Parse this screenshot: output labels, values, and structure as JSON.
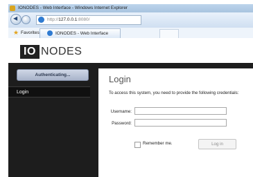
{
  "window": {
    "title": "IONODES - Web Interface - Windows Internet Explorer"
  },
  "browser": {
    "address_prefix": "http://",
    "address_host": "127.0.0.1",
    "address_port": ":8080/",
    "favorites_label": "Favorites",
    "tab_title": "IONODES - Web Interface"
  },
  "header": {
    "logo_io": "IO",
    "logo_rest": "NODES"
  },
  "sidebar": {
    "status_button": "Authenticating...",
    "items": [
      {
        "label": "Login"
      }
    ]
  },
  "login": {
    "title": "Login",
    "description": "To access this system, you need to provide the following credentials:",
    "username_label": "Username:",
    "username_value": "",
    "password_label": "Password:",
    "password_value": "",
    "remember_label": "Remember me.",
    "remember_checked": false,
    "submit_label": "Log in"
  },
  "colors": {
    "app_background": "#1d1d1d",
    "panel_background": "#ffffff",
    "status_button": "#b8c2d6"
  }
}
